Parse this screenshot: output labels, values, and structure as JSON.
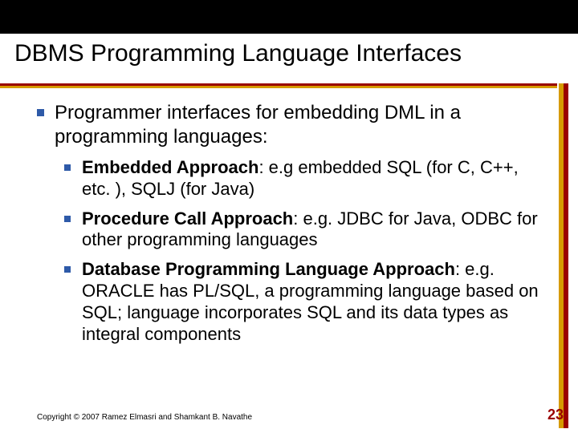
{
  "slide": {
    "title": "DBMS Programming Language Interfaces",
    "intro": "Programmer interfaces for embedding DML in a programming languages:",
    "items": [
      {
        "label": "Embedded Approach",
        "rest": ": e.g embedded SQL (for C, C++, etc. ), SQLJ (for Java)"
      },
      {
        "label": "Procedure Call Approach",
        "rest": ": e.g. JDBC for Java, ODBC for other programming languages"
      },
      {
        "label": "Database Programming Language Approach",
        "rest": ": e.g. ORACLE has PL/SQL, a programming language based on SQL; language incorporates SQL and its data types as integral components"
      }
    ],
    "copyright": "Copyright © 2007 Ramez Elmasri and Shamkant B. Navathe",
    "page": "23"
  }
}
